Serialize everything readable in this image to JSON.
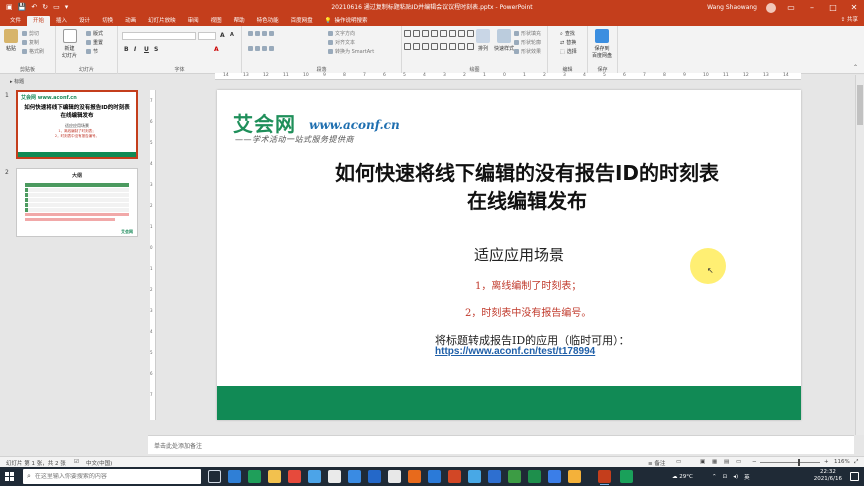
{
  "window": {
    "title": "20210616 通过复制标题粘贴ID并编辑会议议程时刻表.pptx  -  PowerPoint",
    "user": "Wang Shaowang",
    "share": "共享"
  },
  "tabs": [
    {
      "label": "文件"
    },
    {
      "label": "开始",
      "active": true
    },
    {
      "label": "插入"
    },
    {
      "label": "设计"
    },
    {
      "label": "切换"
    },
    {
      "label": "动画"
    },
    {
      "label": "幻灯片放映"
    },
    {
      "label": "审阅"
    },
    {
      "label": "视图"
    },
    {
      "label": "帮助"
    },
    {
      "label": "特色功能"
    },
    {
      "label": "百度网盘"
    }
  ],
  "tell_me": "操作说明搜索",
  "ribbon": {
    "clipboard": {
      "label": "剪贴板",
      "paste": "粘贴",
      "cut": "剪切",
      "copy": "复制",
      "format_painter": "格式刷"
    },
    "slides": {
      "label": "幻灯片",
      "new_slide": "新建\n幻灯片",
      "layout": "版式",
      "reset": "重置",
      "section": "节"
    },
    "font": {
      "label": "字体",
      "bold": "B",
      "italic": "I",
      "underline": "U",
      "strike": "S",
      "font_color": "A"
    },
    "paragraph": {
      "label": "段落",
      "text_direction": "文字方向",
      "align_text": "对齐文本",
      "smartart": "转换为 SmartArt"
    },
    "drawing": {
      "label": "绘图",
      "arrange": "排列",
      "quick_styles": "快速样式",
      "fill": "形状填充",
      "outline": "形状轮廓",
      "effects": "形状效果"
    },
    "editing": {
      "label": "编辑",
      "find": "查找",
      "replace": "替换",
      "select": "选择"
    },
    "save": {
      "label": "保存",
      "save_to": "保存到\n百度网盘"
    }
  },
  "thumbnails": {
    "header": "标题",
    "slide1": {
      "num": "1",
      "logo": "艾会网 www.aconf.cn",
      "title": "如何快速将线下编辑的没有报告ID的时刻表\n在线编辑发布",
      "sub1": "适应应用场景",
      "sub2": "1，离线编制了时刻表；",
      "sub3": "2，时刻表中没有报告编号。"
    },
    "slide2": {
      "num": "2",
      "heading": "大纲",
      "brand": "艾会网"
    }
  },
  "slide": {
    "logo_cn": "艾会网",
    "logo_url": "www.aconf.cn",
    "tagline": "——学术活动一站式服务提供商",
    "title_line1": "如何快速将线下编辑的没有报告ID的时刻表",
    "title_line2": "在线编辑发布",
    "scenario": "适应应用场景",
    "point1": "1，离线编制了时刻表；",
    "point2": "2，时刻表中没有报告编号。",
    "link_intro": "将标题转成报告ID的应用（临时可用）：",
    "link_url": "https://www.aconf.cn/test/t178994"
  },
  "notes": {
    "placeholder": "单击此处添加备注"
  },
  "status": {
    "slide_count": "幻灯片 第 1 张，共 2 张",
    "language": "中文(中国)",
    "notes_btn": "备注",
    "zoom": "116%"
  },
  "taskbar": {
    "search_placeholder": "在这里输入你要搜索的内容",
    "weather": "29°C",
    "ime": "英",
    "time": "22:32",
    "date": "2021/6/16"
  },
  "colors": {
    "accent": "#c43e1c",
    "band": "#118a55",
    "logo_green": "#1f8f5a",
    "link": "#1f5fa8",
    "red_text": "#c0392b"
  }
}
